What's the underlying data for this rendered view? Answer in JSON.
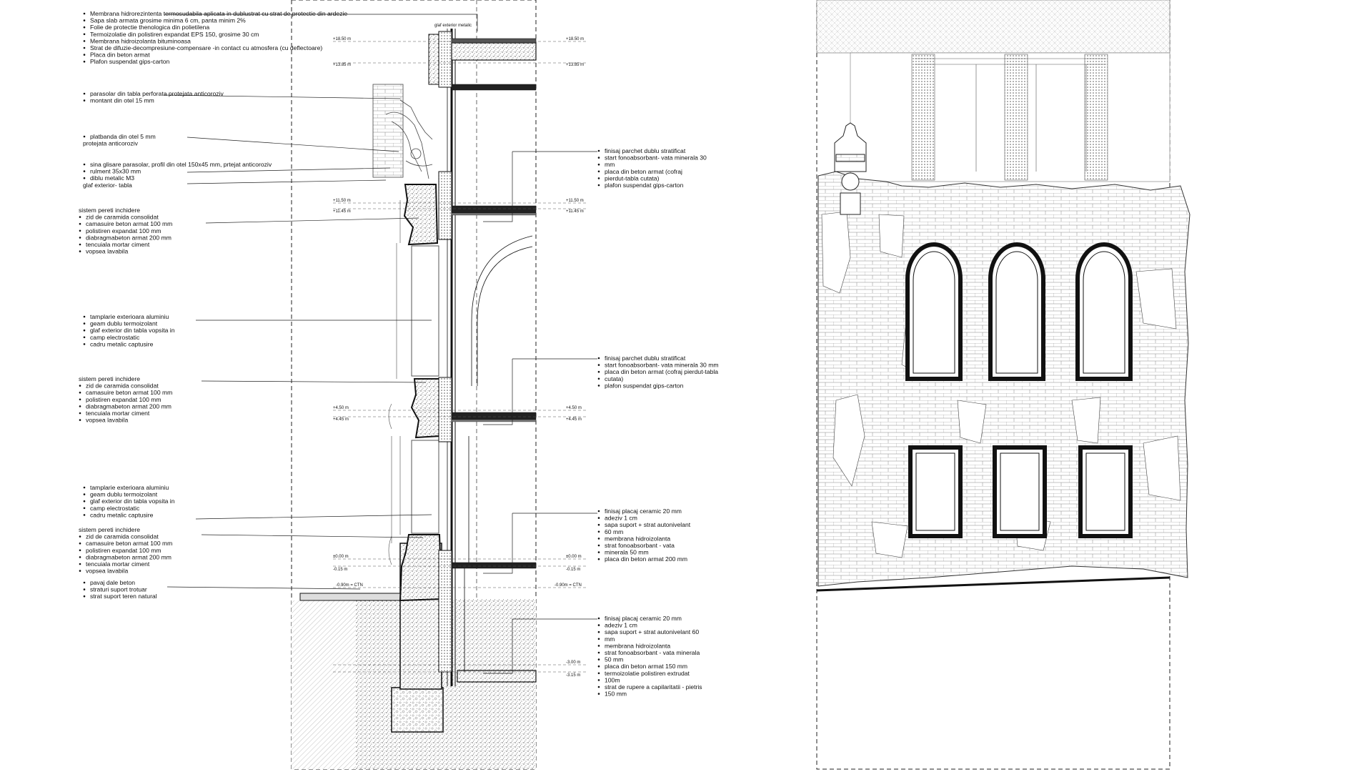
{
  "left_annotations": [
    {
      "id": "roof",
      "bullet": true,
      "lines": [
        "Membrana hidrorezintenta termosudabila aplicata in dublustrat cu strat de protectie din ardezie",
        "Sapa slab armata grosime minima 6 cm, panta minim 2%",
        "Folie de protectie thenologica din polietilena",
        "Termoizolatie din polistiren expandat EPS 150, grosime 30 cm",
        "Membrana hidroizolanta bituminoasa",
        "Strat de difuzie-decompresiune-compensare -in contact cu atmosfera (cu deflectoare)",
        "Placa din beton armat",
        "Plafon suspendat gips-carton"
      ]
    },
    {
      "id": "parasolar",
      "lines": [
        "parasolar din tabla perforata protejata anticoroziv",
        "montant din otel  15 mm"
      ]
    },
    {
      "id": "platbanda",
      "lines": [
        "platbanda din otel 5 mm",
        "protejata anticoroziv"
      ]
    },
    {
      "id": "sina",
      "lines": [
        "sina glisare parasolar, profil din otel 150x45 mm, prtejat anticoroziv",
        "rulment 35x30 mm",
        "diblu metalic M3",
        "glaf exterior- tabla"
      ]
    },
    {
      "id": "walls1",
      "lines": [
        "sistem pereti inchidere",
        "zid de caramida consolidat",
        "camasuire beton armat 100 mm",
        "polistiren expandat 100 mm",
        "diabragmabeton armat 200 mm",
        "tencuiala  mortar ciment",
        "vopsea lavabila"
      ]
    },
    {
      "id": "window1",
      "lines": [
        "tamplarie exterioara aluminiu",
        "geam dublu termoizolant",
        "glaf exterior din tabla vopsita in",
        "camp electrostatic",
        "cadru metalic captusire"
      ]
    },
    {
      "id": "walls2",
      "lines": [
        "sistem pereti inchidere",
        "zid de caramida consolidat",
        "camasuire beton armat 100 mm",
        "polistiren expandat 100 mm",
        "diabragmabeton armat 200 mm",
        "tencuiala  mortar ciment",
        "vopsea lavabila"
      ]
    },
    {
      "id": "window2",
      "lines": [
        "tamplarie exterioara aluminiu",
        "geam dublu termoizolant",
        "glaf exterior din tabla vopsita in",
        "camp electrostatic",
        "cadru metalic captusire"
      ]
    },
    {
      "id": "walls3",
      "lines": [
        "sistem pereti inchidere",
        "zid de caramida consolidat",
        "camasuire beton armat 100 mm",
        "polistiren expandat 100 mm",
        "diabragmabeton armat 200 mm",
        "tencuiala  mortar ciment",
        "vopsea lavabila"
      ]
    },
    {
      "id": "pavaj",
      "lines": [
        "pavaj dale beton",
        "straturi suport trotuar",
        "strat suport teren natural"
      ]
    }
  ],
  "right_annotations": [
    {
      "id": "floor3",
      "lines": [
        "finisaj  parchet dublu stratificat",
        "start fonoabsorbant- vata minerala 30",
        "mm",
        "placa din beton armat (cofraj",
        "pierdut-tabla cutata)",
        "plafon suspendat gips-carton"
      ]
    },
    {
      "id": "floor2",
      "lines": [
        "finisaj  parchet dublu stratificat",
        "start fonoabsorbant- vata minerala 30 mm",
        "placa din beton armat (cofraj pierdut-tabla",
        "cutata)",
        "plafon suspendat gips-carton"
      ]
    },
    {
      "id": "floor1",
      "lines": [
        "finisaj placaj ceramic 20 mm",
        "adeziv 1 cm",
        "sapa suport + strat autonivelant",
        "60 mm",
        "membrana hidroizolanta",
        "strat fonoabsorbant - vata",
        "minerala 50 mm",
        "placa din beton armat 200 mm"
      ]
    },
    {
      "id": "basement",
      "lines": [
        "finisaj placaj ceramic 20 mm",
        "adeziv 1 cm",
        "sapa suport + strat autonivelant 60",
        "mm",
        "membrana hidroizolanta",
        "strat fonoabsorbant - vata minerala",
        "50 mm",
        "placa din beton armat 150 mm",
        "termoizolatie polistiren extrudat",
        "100m",
        "strat de rupere a capilaritatii - pietris",
        "150 mm"
      ]
    }
  ],
  "section_labels": {
    "glaf_top": "glaf exterior metalic",
    "lvl_roof_a": "+18.50 m",
    "lvl_roof_b": "+13.85 m",
    "lvl_f3_a": "+11.50 m",
    "lvl_f3_b": "+11.45 m",
    "lvl_f2_a": "+4.50 m",
    "lvl_f2_b": "+4.45 m",
    "lvl_f1_a": "±0.00 m",
    "lvl_f1_b": "-0.15 m",
    "lvl_ctn": "-0.90m = CTN",
    "lvl_base_a": "-3.00 m",
    "lvl_base_b": "-3.15 m"
  }
}
